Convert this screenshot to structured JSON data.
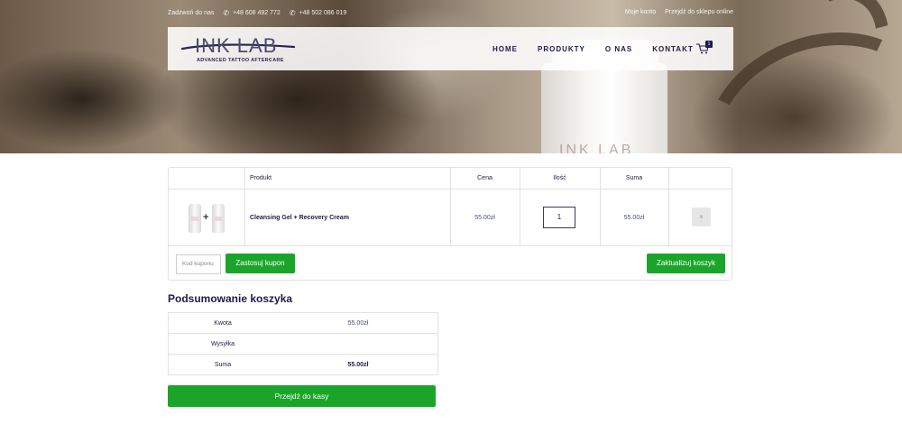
{
  "topbar": {
    "contact_label": "Zadzwoń do nas",
    "phone1": "+48 608 492 772",
    "phone2": "+48 502 086 019",
    "account_link": "Moje konto",
    "shop_link": "Przejdź do sklepu online"
  },
  "header": {
    "logo_text": "INK LAB",
    "logo_sub": "ADVANCED TATTOO AFTERCARE",
    "menu": [
      {
        "label": "HOME"
      },
      {
        "label": "PRODUKTY"
      },
      {
        "label": "O NAS"
      },
      {
        "label": "KONTAKT"
      }
    ],
    "cart_count": "1",
    "hero_bottle_text": "INK LAB"
  },
  "cart": {
    "headers": {
      "product": "Produkt",
      "price": "Cena",
      "quantity": "Ilość",
      "total": "Suma"
    },
    "items": [
      {
        "name": "Cleansing Gel + Recovery Cream",
        "price": "55.00zł",
        "quantity": "1",
        "total": "55.00zł",
        "remove": "×"
      }
    ],
    "coupon_placeholder": "Kod kuponu",
    "apply_coupon": "Zastosuj kupon",
    "update_cart": "Zaktualizuj koszyk"
  },
  "summary": {
    "title": "Podsumowanie koszyka",
    "rows": [
      {
        "label": "Kwota",
        "value": "55.00zł"
      },
      {
        "label": "Wysyłka",
        "value": ""
      },
      {
        "label": "Suma",
        "value": "55.00zł"
      }
    ],
    "checkout": "Przejdź do kasy"
  },
  "colors": {
    "brand_navy": "#1e1b46",
    "button_green": "#1aa52a"
  }
}
